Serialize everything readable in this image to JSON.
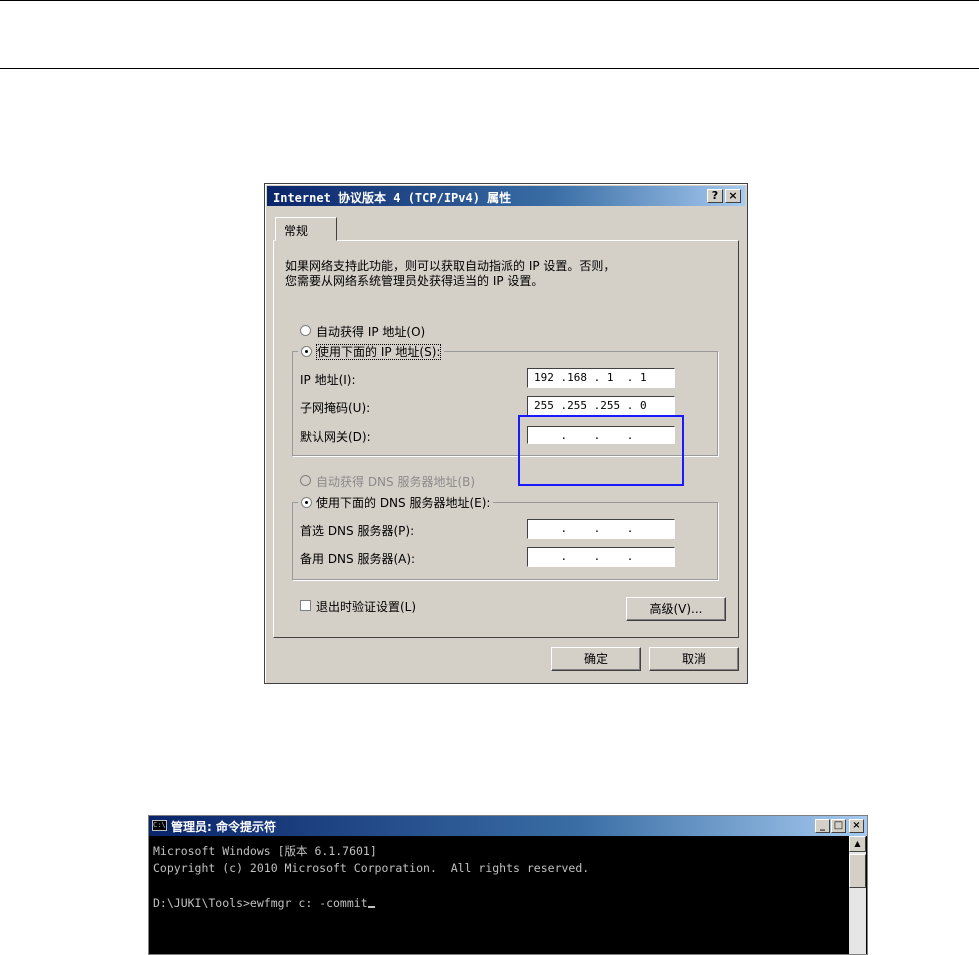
{
  "dialog": {
    "title": "Internet 协议版本 4 (TCP/IPv4) 属性",
    "help_btn": "?",
    "close_btn": "×",
    "tab": "常规",
    "description_line1": "如果网络支持此功能，则可以获取自动指派的 IP 设置。否则，",
    "description_line2": "您需要从网络系统管理员处获得适当的 IP 设置。",
    "radio_auto_ip": "自动获得 IP 地址(O)",
    "radio_manual_ip": "使用下面的 IP 地址(S):",
    "ip_label": "IP 地址(I):",
    "ip_value": "192 .168 . 1  . 1",
    "subnet_label": "子网掩码(U):",
    "subnet_value": "255 .255 .255 . 0",
    "gateway_label": "默认网关(D):",
    "gateway_value": "    .    .    .",
    "radio_auto_dns": "自动获得 DNS 服务器地址(B)",
    "radio_manual_dns": "使用下面的 DNS 服务器地址(E):",
    "preferred_dns_label": "首选 DNS 服务器(P):",
    "preferred_dns_value": "    .    .    .",
    "alternate_dns_label": "备用 DNS 服务器(A):",
    "alternate_dns_value": "    .    .    .",
    "validate_checkbox": "退出时验证设置(L)",
    "advanced_btn": "高级(V)...",
    "ok_btn": "确定",
    "cancel_btn": "取消"
  },
  "console": {
    "title": "管理员: 命令提示符",
    "icon_text": "C:\\",
    "min_btn": "_",
    "max_btn": "□",
    "close_btn": "×",
    "line1": "Microsoft Windows [版本 6.1.7601]",
    "line2": "Copyright (c) 2010 Microsoft Corporation.  All rights reserved.",
    "line3": "D:\\JUKI\\Tools>ewfmgr c: -commit",
    "scroll_up": "▲"
  }
}
